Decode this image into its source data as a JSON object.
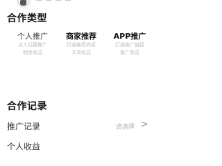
{
  "header": {
    "title": "— — — —",
    "avatar_icon": "avatar-icon"
  },
  "section_type": {
    "title": "合作类型",
    "items": [
      {
        "label": "个人推广",
        "desc_1": "达人招募推广",
        "desc_2": "佣金收益",
        "style": "normal"
      },
      {
        "label": "商家推荐",
        "desc_1": "打通推荐商家",
        "desc_2": "共享收益",
        "style": "bold"
      },
      {
        "label": "APP推广",
        "desc_1": "打通推广链接",
        "desc_2": "推广收益",
        "style": "bold"
      }
    ]
  },
  "section_record": {
    "title": "合作记录",
    "rows": [
      {
        "label": "推广记录",
        "value": "请选择",
        "icon": "chevron-right-icon",
        "chevron": ">"
      },
      {
        "label": "个人收益",
        "value": "",
        "icon": "",
        "chevron": ""
      }
    ]
  }
}
